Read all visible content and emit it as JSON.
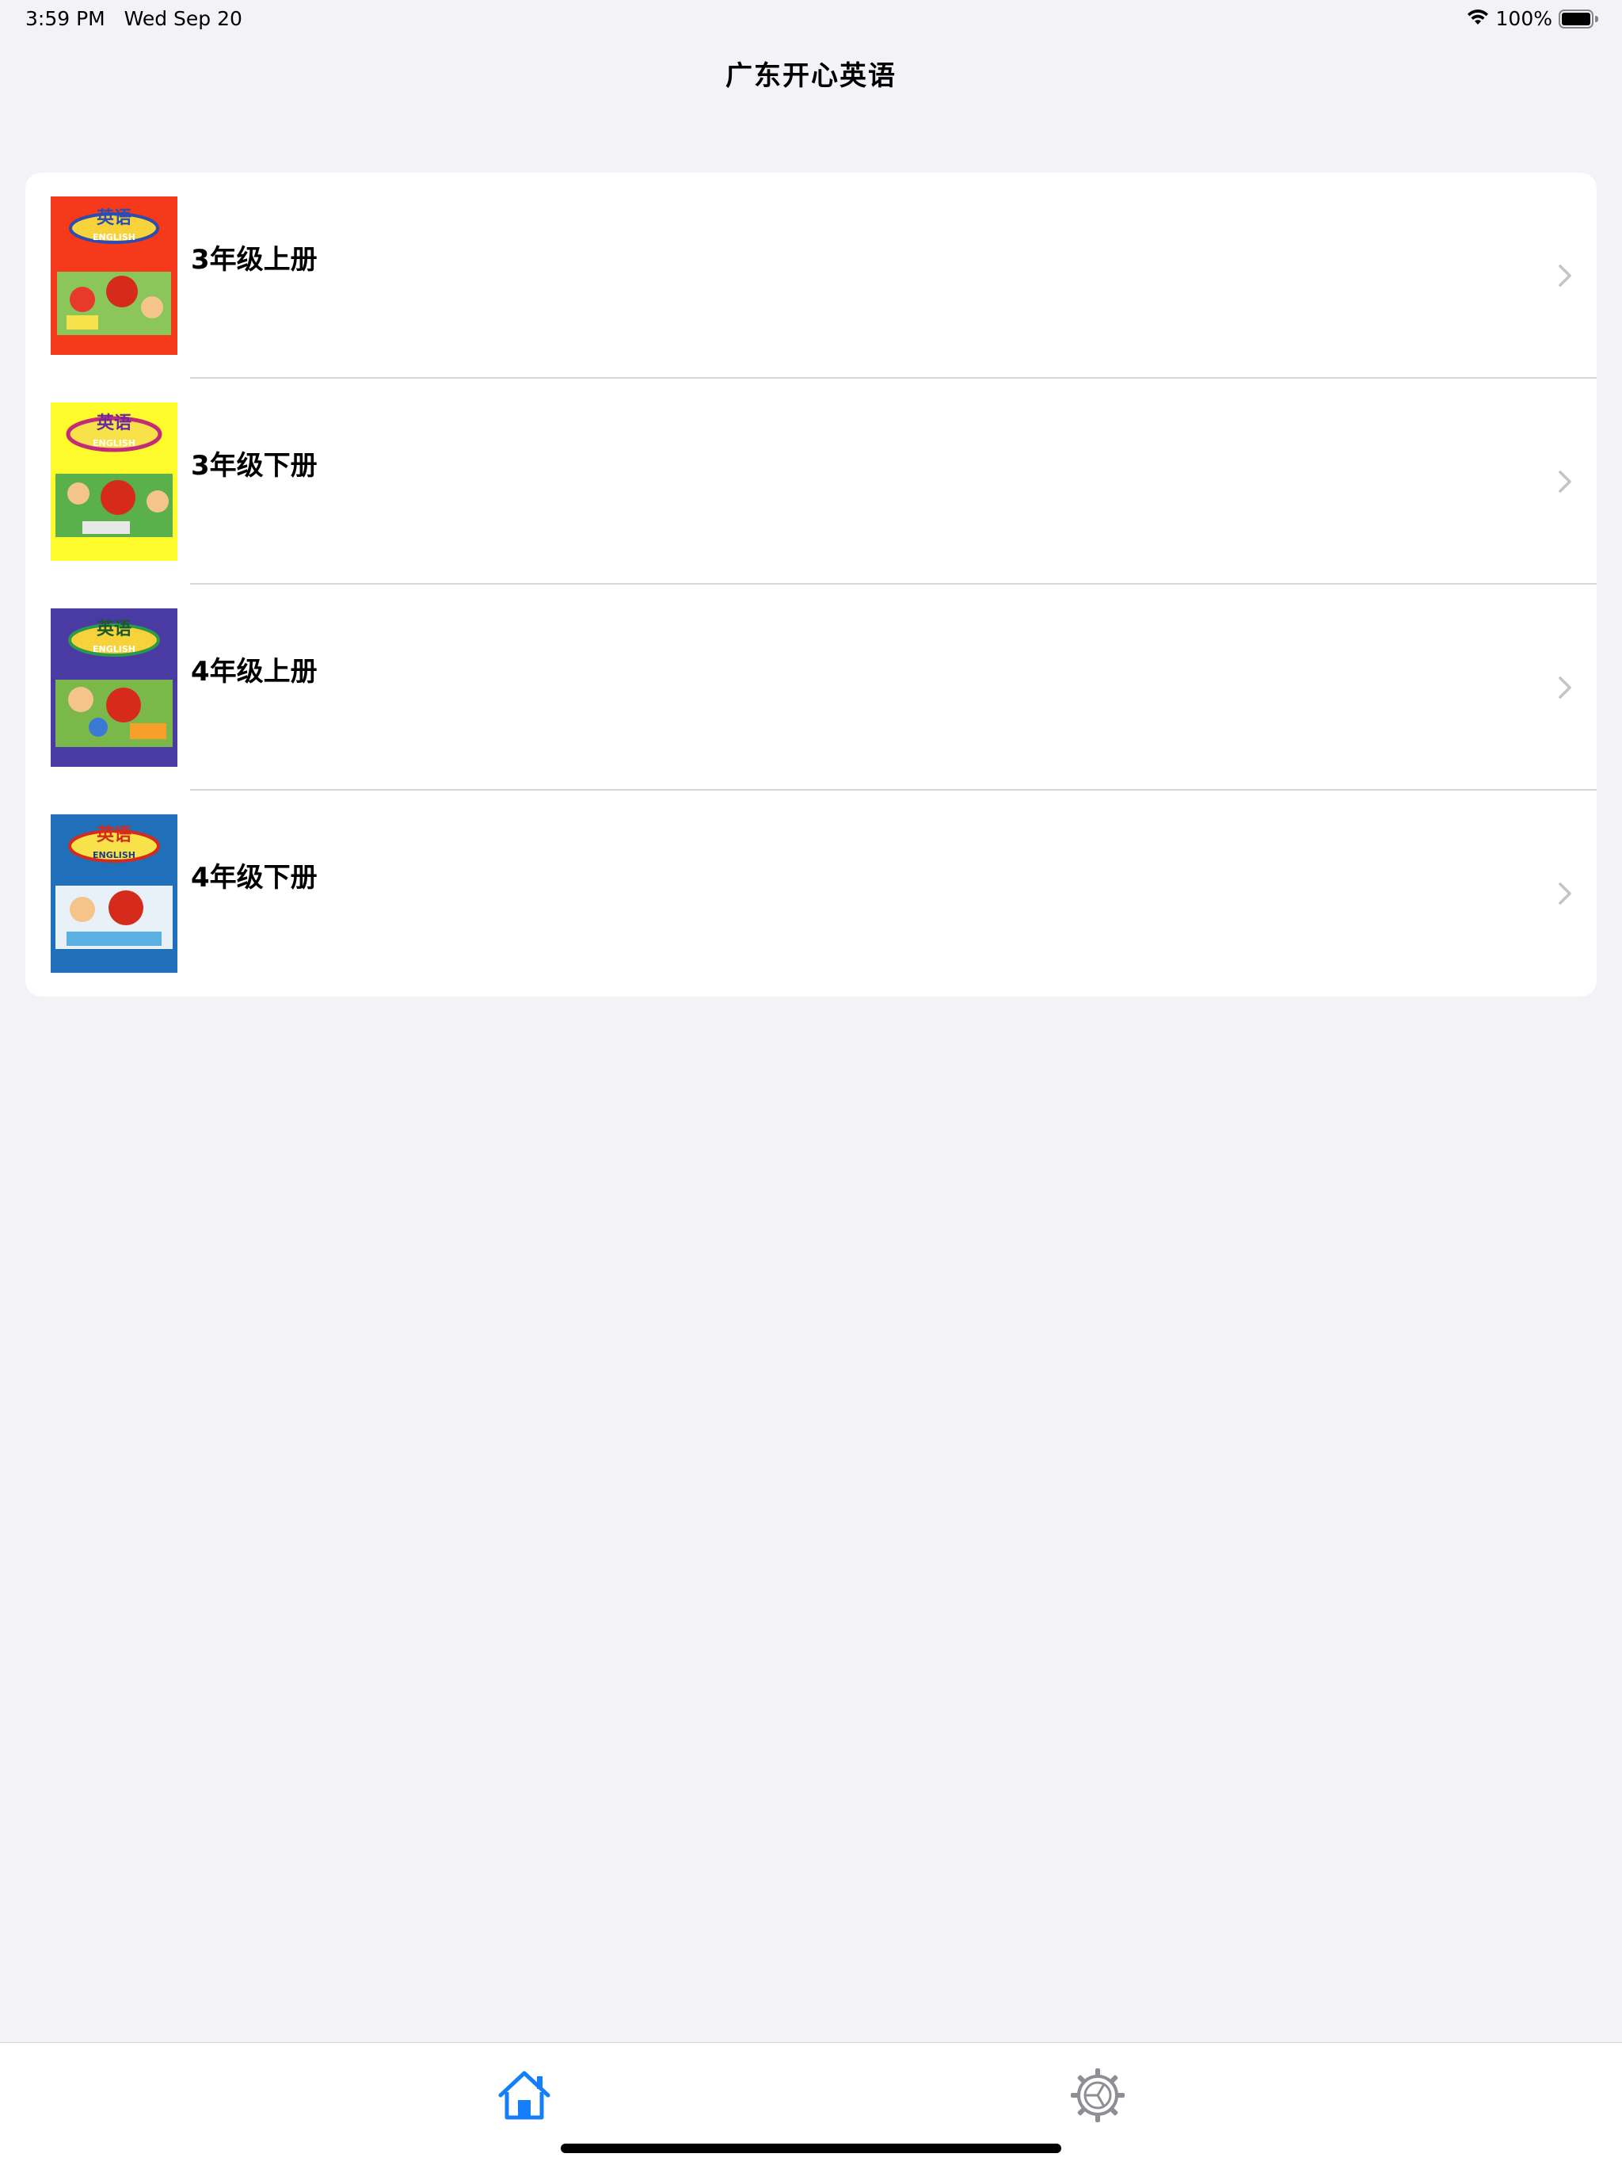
{
  "status_bar": {
    "time_date": "3:59 PM   Wed Sep 20",
    "battery_text": "100%",
    "battery_level": 1.0,
    "wifi_icon": "wifi-icon",
    "battery_icon": "battery-icon"
  },
  "nav": {
    "title": "广东开心英语"
  },
  "books": {
    "items": [
      {
        "label": "3年级上册",
        "cover_icon": "book-cover-image",
        "cover_color": "#f53a1b",
        "cover_title": "英语",
        "cover_subtitle": "ENGLISH"
      },
      {
        "label": "3年级下册",
        "cover_icon": "book-cover-image",
        "cover_color": "#fdfb2c",
        "cover_title": "英语",
        "cover_subtitle": "ENGLISH"
      },
      {
        "label": "4年级上册",
        "cover_icon": "book-cover-image",
        "cover_color": "#4a3aa3",
        "cover_title": "英语",
        "cover_subtitle": "ENGLISH"
      },
      {
        "label": "4年级下册",
        "cover_icon": "book-cover-image",
        "cover_color": "#1f6fba",
        "cover_title": "英语",
        "cover_subtitle": "ENGLISH"
      }
    ]
  },
  "tab_bar": {
    "tabs": [
      {
        "icon": "home-icon",
        "selected": true,
        "color": "#147efb"
      },
      {
        "icon": "gear-icon",
        "selected": false,
        "color": "#8e8e93"
      }
    ]
  },
  "colors": {
    "background": "#f2f2f7",
    "card": "#ffffff",
    "separator": "#d8d8dc",
    "chevron": "#c4c4c7",
    "accent": "#147efb",
    "tab_inactive": "#8e8e93"
  }
}
